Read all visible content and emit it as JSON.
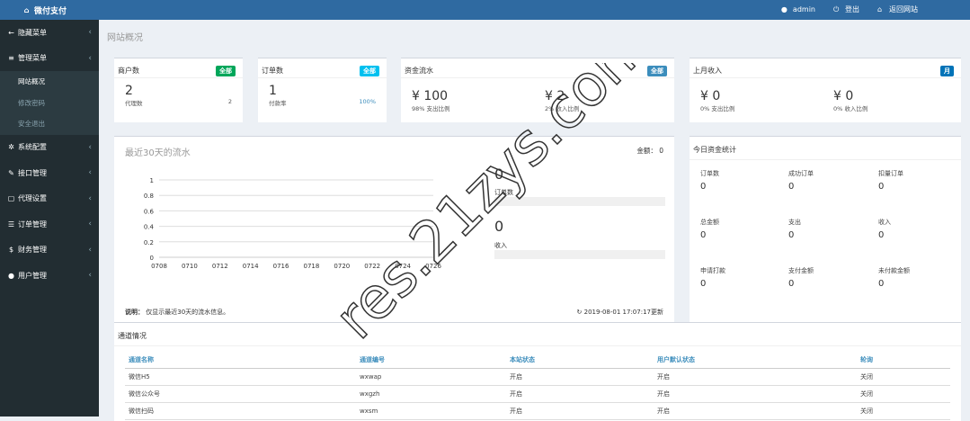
{
  "topbar": {
    "brand": "微付支付",
    "user": "admin",
    "logout": "登出",
    "back": "返回网站"
  },
  "sidebar": {
    "items": [
      {
        "label": "隐藏菜单",
        "icon": "arrow-left-icon"
      },
      {
        "label": "管理菜单",
        "icon": "bars-icon"
      },
      {
        "label": "系统配置",
        "icon": "gear-icon"
      },
      {
        "label": "接口管理",
        "icon": "pencil-icon"
      },
      {
        "label": "代理设置",
        "icon": "square-icon"
      },
      {
        "label": "订单管理",
        "icon": "list-icon"
      },
      {
        "label": "财务管理",
        "icon": "dollar-icon"
      },
      {
        "label": "用户管理",
        "icon": "user-icon"
      }
    ],
    "sub": [
      "网站概况",
      "修改密码",
      "安全退出"
    ]
  },
  "page": {
    "title": "网站概况"
  },
  "cards": [
    {
      "title": "商户数",
      "badge": "全部",
      "value": "2",
      "sub": "代理数",
      "sub_val": "2"
    },
    {
      "title": "订单数",
      "badge": "全部",
      "value": "1",
      "sub": "付款率",
      "sub_val": "100%"
    },
    {
      "title": "资金流水",
      "badge": "全部",
      "v1": "¥ 100",
      "s1": "98% 支出比例",
      "v2": "¥ 2",
      "s2": "2% 收入比例"
    },
    {
      "title": "上月收入",
      "badge": "月",
      "v1": "¥ 0",
      "s1": "0% 支出比例",
      "v2": "¥ 0",
      "s2": "0% 收入比例"
    }
  ],
  "flow": {
    "title": "最近30天的流水",
    "amount_label": "金额：",
    "amount": "0",
    "order_val": "0",
    "order_label": "订单数",
    "income_val": "0",
    "income_label": "收入",
    "note_label": "说明：",
    "note": "仅显示最近30天的流水信息。",
    "updated": "2019-08-01 17:07:17更新"
  },
  "chart_data": {
    "type": "line",
    "categories": [
      "0708",
      "0710",
      "0712",
      "0714",
      "0716",
      "0718",
      "0720",
      "0722",
      "0724",
      "0726"
    ],
    "yticks": [
      "1",
      "0.8",
      "0.6",
      "0.4",
      "0.2",
      "0"
    ],
    "ylim": [
      0,
      1
    ],
    "series": [
      {
        "values": [
          0,
          0,
          0,
          0,
          0,
          0,
          0,
          0,
          0,
          0
        ]
      }
    ]
  },
  "today": {
    "title": "今日资金统计",
    "cells": [
      {
        "label": "订单数",
        "value": "0"
      },
      {
        "label": "成功订单",
        "value": "0"
      },
      {
        "label": "扣量订单",
        "value": "0"
      },
      {
        "label": "总金额",
        "value": "0"
      },
      {
        "label": "支出",
        "value": "0"
      },
      {
        "label": "收入",
        "value": "0"
      },
      {
        "label": "申请打款",
        "value": "0"
      },
      {
        "label": "支付金额",
        "value": "0"
      },
      {
        "label": "未付款金额",
        "value": "0"
      }
    ]
  },
  "channels": {
    "title": "通道情况",
    "headers": [
      "通道名称",
      "通道编号",
      "本站状态",
      "用户默认状态",
      "轮询"
    ],
    "rows": [
      [
        "微信H5",
        "wxwap",
        "开启",
        "开启",
        "关闭"
      ],
      [
        "微信公众号",
        "wxgzh",
        "开启",
        "开启",
        "关闭"
      ],
      [
        "微信扫码",
        "wxsm",
        "开启",
        "开启",
        "关闭"
      ]
    ]
  },
  "watermark": "res.21zys.com"
}
